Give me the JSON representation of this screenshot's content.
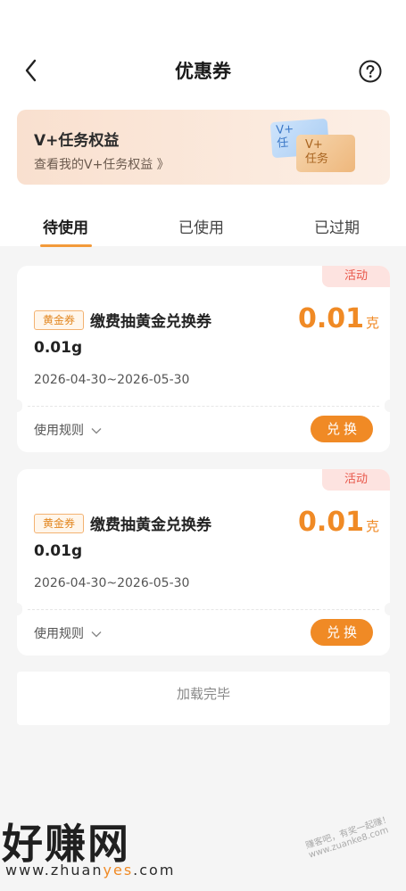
{
  "header": {
    "title": "优惠券",
    "back_icon": "chevron-left-icon",
    "help_icon": "question-circle-icon"
  },
  "banner": {
    "title": "V+任务权益",
    "subtitle": "查看我的V+任务权益 》",
    "card_blue_text": "V+\n任",
    "card_gold_text": "V+\n任务"
  },
  "tabs": [
    {
      "label": "待使用",
      "active": true
    },
    {
      "label": "已使用",
      "active": false
    },
    {
      "label": "已过期",
      "active": false
    }
  ],
  "coupons": [
    {
      "tag": "活动",
      "badge": "黄金券",
      "name": "缴费抽黄金兑换券",
      "weight": "0.01g",
      "value": "0.01",
      "unit": "克",
      "date": "2026-04-30~2026-05-30",
      "rules_label": "使用规则",
      "button_label": "兑换"
    },
    {
      "tag": "活动",
      "badge": "黄金券",
      "name": "缴费抽黄金兑换券",
      "weight": "0.01g",
      "value": "0.01",
      "unit": "克",
      "date": "2026-04-30~2026-05-30",
      "rules_label": "使用规则",
      "button_label": "兑换"
    }
  ],
  "footer": {
    "loaded_text": "加载完毕"
  },
  "watermark": {
    "logo": "好赚网",
    "url_pre": "www.zhuan",
    "url_hl": "yes",
    "url_post": ".com",
    "small": "赚客吧，有奖一起赚！www.zuanke8.com"
  },
  "colors": {
    "accent": "#f08a25",
    "activity_red": "#e8574a",
    "background": "#f5f5f5"
  }
}
